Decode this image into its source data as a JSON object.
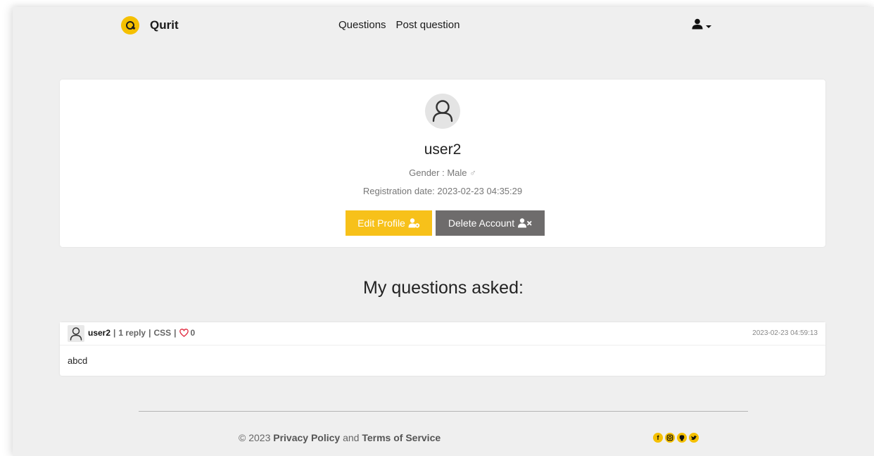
{
  "navbar": {
    "brand_name": "Qurit",
    "links": [
      "Questions",
      "Post question"
    ],
    "user_icon": "user-icon"
  },
  "profile": {
    "username": "user2",
    "gender_label": "Gender : Male",
    "gender_symbol": "♂",
    "registration": "Registration date: 2023-02-23 04:35:29",
    "edit_button": "Edit Profile",
    "delete_button": "Delete Account",
    "avatar_icon": "user-outline-icon"
  },
  "section_title": "My questions asked:",
  "questions": [
    {
      "user": "user2",
      "replies": "1 reply",
      "tag": "CSS",
      "likes": "0",
      "date": "2023-02-23 04:59:13",
      "body": "abcd"
    }
  ],
  "footer": {
    "copyright": "© 2023",
    "privacy": "Privacy Policy",
    "and": "and",
    "terms": "Terms of Service",
    "socials": [
      "facebook-icon",
      "instagram-icon",
      "github-icon",
      "twitter-icon"
    ]
  },
  "colors": {
    "accent": "#f5c000",
    "edit_button": "#f7c11a",
    "delete_button": "#6e6c6c",
    "background": "#efefef",
    "heart": "#e0243a"
  }
}
